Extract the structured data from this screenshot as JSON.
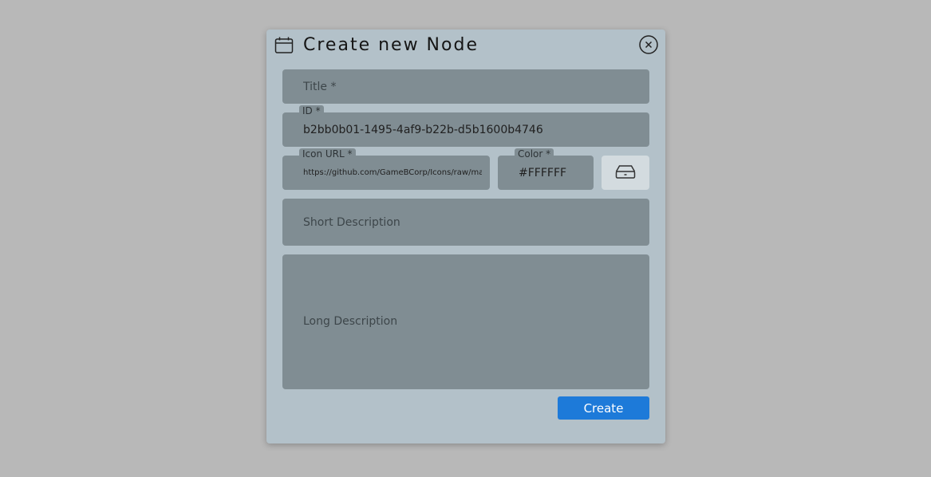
{
  "dialog": {
    "title": "Create new Node",
    "header_icon": "calendar-icon",
    "close_icon": "close-circle-icon"
  },
  "fields": {
    "title": {
      "placeholder": "Title *",
      "value": ""
    },
    "id": {
      "label": "ID *",
      "value": "b2bb0b01-1495-4af9-b22b-d5b1600b4746"
    },
    "icon_url": {
      "label": "Icon URL *",
      "value": "https://github.com/GameBCorp/Icons/raw/master/"
    },
    "color": {
      "label": "Color *",
      "value": "#FFFFFF"
    },
    "short_description": {
      "placeholder": "Short Description",
      "value": ""
    },
    "long_description": {
      "placeholder": "Long Description",
      "value": ""
    }
  },
  "actions": {
    "icon_picker_icon": "drive-icon",
    "create_label": "Create"
  },
  "colors": {
    "backdrop": "#b8b8b8",
    "dialog_bg": "#b3c1c9",
    "field_bg": "#808d93",
    "picker_bg": "#d3dbdf",
    "primary": "#1d7ad9"
  }
}
